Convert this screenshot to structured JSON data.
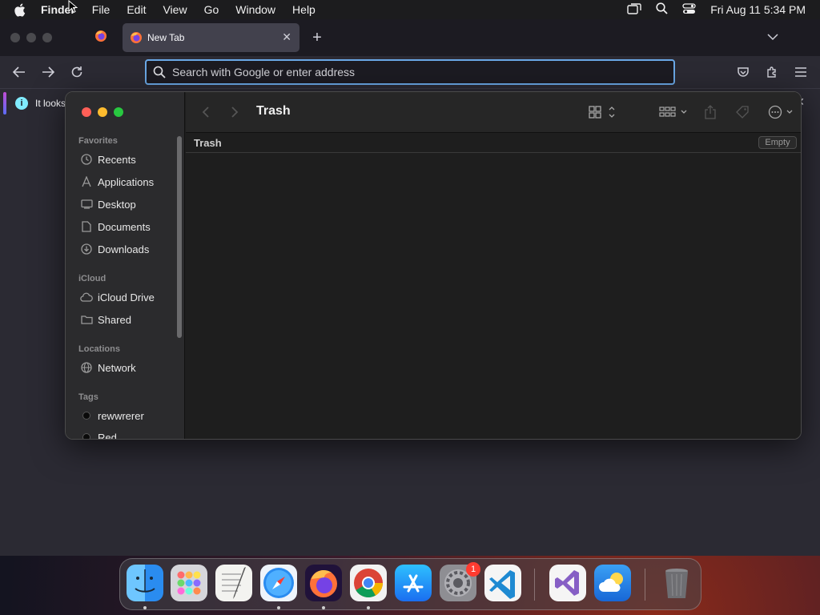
{
  "menubar": {
    "app_name": "Finder",
    "menus": [
      "File",
      "Edit",
      "View",
      "Go",
      "Window",
      "Help"
    ],
    "clock": "Fri Aug 11  5:34 PM",
    "status_icons": [
      "screen-mirroring-icon",
      "spotlight-search-icon",
      "control-center-icon"
    ]
  },
  "browser": {
    "tab_title": "New Tab",
    "new_tab_symbol": "+",
    "close_symbol": "✕",
    "urlbar_placeholder": "Search with Google or enter address",
    "notification_text": "It looks",
    "notification_close": "✕",
    "info_symbol": "i"
  },
  "finder": {
    "title": "Trash",
    "path_label": "Trash",
    "empty_button": "Empty",
    "sidebar": {
      "favorites_heading": "Favorites",
      "favorites": [
        {
          "label": "Recents",
          "icon": "clock-icon"
        },
        {
          "label": "Applications",
          "icon": "applications-icon"
        },
        {
          "label": "Desktop",
          "icon": "desktop-icon"
        },
        {
          "label": "Documents",
          "icon": "document-icon"
        },
        {
          "label": "Downloads",
          "icon": "download-icon"
        }
      ],
      "icloud_heading": "iCloud",
      "icloud": [
        {
          "label": "iCloud Drive",
          "icon": "cloud-icon"
        },
        {
          "label": "Shared",
          "icon": "shared-folder-icon"
        }
      ],
      "locations_heading": "Locations",
      "locations": [
        {
          "label": "Network",
          "icon": "globe-icon"
        }
      ],
      "tags_heading": "Tags",
      "tags": [
        {
          "label": "rewwrerer",
          "color": "#0a0a0a"
        },
        {
          "label": "Red",
          "color": "#0a0a0a"
        }
      ]
    }
  },
  "dock": {
    "apps": [
      "Finder",
      "Launchpad",
      "TextEdit",
      "Safari",
      "Firefox",
      "Chrome",
      "App Store",
      "System Settings",
      "Visual Studio Code",
      "Visual Studio",
      "Weather",
      "Trash"
    ],
    "system_settings_badge": "1"
  },
  "colors": {
    "accent_blue": "#6aa8e6",
    "close_red": "#ff5f57",
    "minimize_yellow": "#febc2e",
    "zoom_green": "#28c840"
  }
}
